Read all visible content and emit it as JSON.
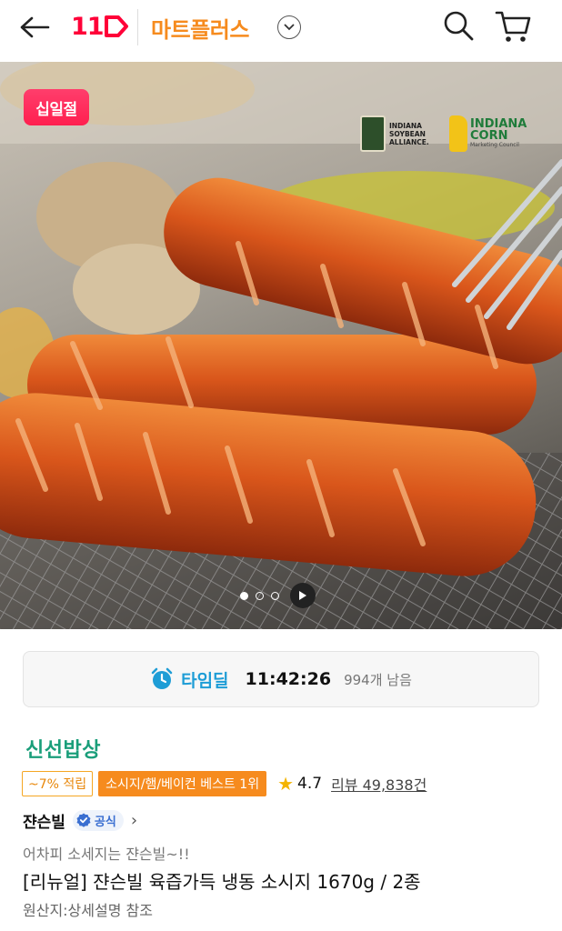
{
  "header": {
    "logo": "11",
    "mall_name": "마트플러스"
  },
  "hero": {
    "badge": "십일절",
    "partner_logos": {
      "soybean_lines": [
        "INDIANA",
        "SOYBEAN",
        "ALLIANCE."
      ],
      "corn_line1": "INDIANA",
      "corn_line2": "CORN",
      "corn_sub": "Marketing Council"
    },
    "carousel": {
      "total": 3,
      "active": 1
    }
  },
  "timedeal": {
    "label": "타임딜",
    "time": "11:42:26",
    "remaining": "994개 남음"
  },
  "product": {
    "brand_category": "신선밥상",
    "point_tag": "~7% 적립",
    "best_tag": "소시지/햄/베이컨 베스트 1위",
    "rating": "4.7",
    "review_text": "리뷰 49,838건",
    "seller": "쟌슨빌",
    "official_label": "공식",
    "promo_text": "어차피 소세지는 쟌슨빌~!!",
    "title": "[리뉴얼] 쟌슨빌 육즙가득 냉동 소시지 1670g / 2종",
    "origin": "원산지:상세설명 참조"
  },
  "colors": {
    "logo_red": "#ff0038",
    "mall_orange": "#f68b1e",
    "timedeal_blue": "#1e9dd6",
    "brand_green": "#1a9e7a"
  }
}
